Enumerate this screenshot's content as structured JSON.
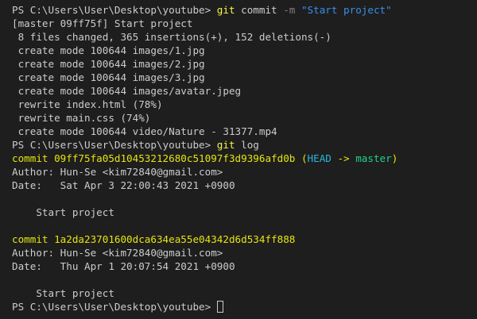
{
  "prompt": "PS C:\\Users\\User\\Desktop\\youtube> ",
  "cmd1": {
    "program": "git",
    "subcommand": " commit ",
    "flag": "-m",
    "message": " \"Start project\""
  },
  "commit_output": [
    "[master 09ff75f] Start project",
    " 8 files changed, 365 insertions(+), 152 deletions(-)",
    " create mode 100644 images/1.jpg",
    " create mode 100644 images/2.jpg",
    " create mode 100644 images/3.jpg",
    " create mode 100644 images/avatar.jpeg",
    " rewrite index.html (78%)",
    " rewrite main.css (74%)",
    " create mode 100644 video/Nature - 31377.mp4"
  ],
  "cmd2": {
    "program": "git",
    "subcommand": " log"
  },
  "log": [
    {
      "commit_line": "commit 09ff75fa05d10453212680c51097f3d9396afd0b",
      "refs": {
        "open": " (",
        "head": "HEAD",
        "arrow": " -> ",
        "branch": "master",
        "close": ")"
      },
      "author": "Author: Hun-Se <kim72840@gmail.com>",
      "date": "Date:   Sat Apr 3 22:00:43 2021 +0900",
      "message": "    Start project"
    },
    {
      "commit_line": "commit 1a2da23701600dca634ea55e04342d6d534ff888",
      "author": "Author: Hun-Se <kim72840@gmail.com>",
      "date": "Date:   Thu Apr 1 20:07:54 2021 +0900",
      "message": "    Start project"
    }
  ],
  "colors": {
    "background": "#1e1e1e",
    "text": "#cccccc",
    "command": "#f5f543",
    "flag": "#808080",
    "string": "#3b8eea",
    "commit_hash": "#e5e510",
    "head_ref": "#29b8db",
    "branch_ref": "#23d18b"
  }
}
